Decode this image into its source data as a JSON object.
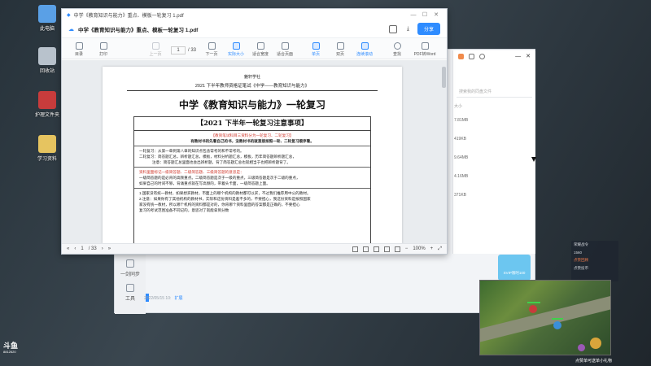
{
  "desktop": {
    "icons": [
      {
        "label": "此电脑",
        "color": "#5aa0e6"
      },
      {
        "label": "回收站",
        "color": "#b8c2cc"
      },
      {
        "label": "护理文件夹",
        "color": "#c83c3c"
      },
      {
        "label": "学习资料",
        "color": "#e6c460"
      }
    ],
    "logo": "斗鱼",
    "logo_sub": "8812620",
    "bottom_right_text": "点赞单可送单小礼物"
  },
  "bg_window": {
    "side_items": [
      "一剑同步",
      "工具"
    ],
    "row_date": "2022/05/15 10:",
    "row_tag": "扩展",
    "right_search_placeholder": "搜索我的同盘文件",
    "right_head": "大小",
    "sizes": [
      "7.81MB",
      "419KB",
      "9.64MB",
      "4.16MB",
      "371KB"
    ],
    "popup_label": "SVIP限时100"
  },
  "pdf": {
    "window_title": "中学《教育知识与能力》重点、模板一轮复习  1.pdf",
    "file_name": "中学《教育知识与能力》重点、模板一轮复习 1.pdf",
    "share_label": "分享",
    "toolbar": {
      "items": [
        "目录",
        "打印"
      ],
      "prev": "上一页",
      "page_current": "1",
      "page_total": "/ 33",
      "next": "下一页",
      "view_items": [
        "实际大小",
        "适合宽度",
        "适合页面",
        "单页",
        "双页",
        "连续滚动",
        "查找",
        "PDF转Word"
      ]
    },
    "page": {
      "school": "魅轩学社",
      "exam_line": "2021 下半年教师资格证笔试《中学——教育知识与能力》",
      "title": "中学《教育知识与能力》一轮复习",
      "box_title": "【2021 下半年一轮复习注意事项】",
      "lines": [
        "【教资笔试科目三资料分为一轮复习、二轮复习】",
        "有教材书的先看自己的书，没教材书的就直接按照一轮、二轮复习顺序看。",
        "一轮复习：从第一章到第八章的知识点包含常考的和不常考的。",
        "二轮复习：简答题汇总，辨析题汇总，模板，材料分析题汇总，模板，历年简答题辨析题汇总，",
        "注意：简答题汇总里面也会出辨析题，背了简答题汇总也就相当于也把辨析题背了。",
        "资料里面标记一级简答题、二级简答题、三级简答题的意思是：",
        "一级简答题的是必背的高频重点。二级简答题是次于一级的重点，三级简答题是次于二级的重点，",
        "如果自己的时间不够，背诵重点就在写高频的，带着头卡面，一级简答题上面。",
        "1.国家没有统一教材，如果想买教材，市面上的哪个机构的教材都可以买，不过我们推荐用中公的教材。",
        "2.注意：如果你有了其他机构的教材书，实际和这份资料是差不多的，不要担心，我这份资料是按照国家",
        "家没有统一教材，所以哪个机构的资料都是对的，你背哪个资料里面的答案都是正确的，不要担心",
        "复习的考试范围准备不同记的，意思对了就能拿到分数"
      ]
    },
    "status": {
      "page_current": "1",
      "page_total": "/ 33",
      "zoom": "100%"
    }
  },
  "game_chat": {
    "title": "荣耀战令",
    "lines": [
      "1560",
      "点赞回顾",
      "点赞投币"
    ]
  }
}
